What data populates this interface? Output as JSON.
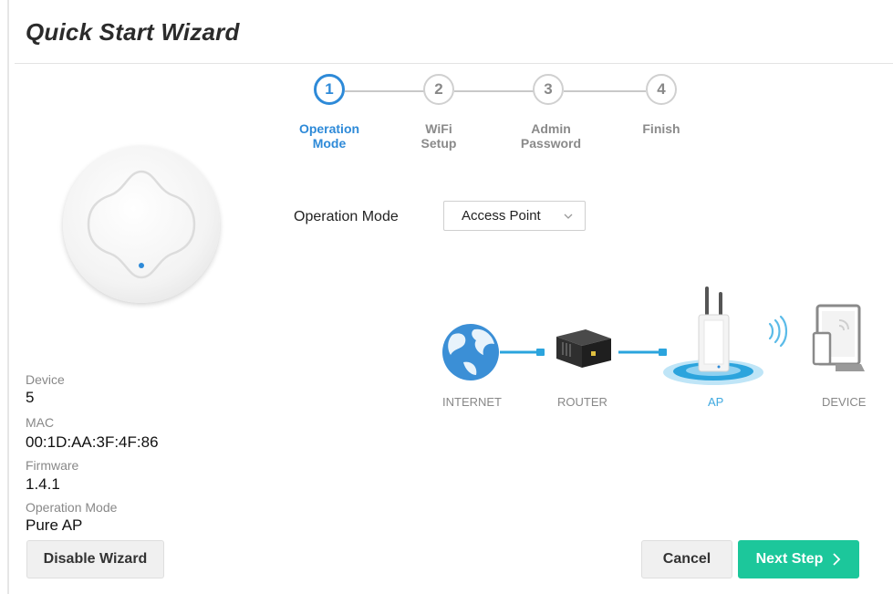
{
  "header": {
    "title": "Quick Start Wizard"
  },
  "steps": [
    {
      "number": "1",
      "label_line1": "Operation",
      "label_line2": "Mode",
      "active": true
    },
    {
      "number": "2",
      "label_line1": "WiFi",
      "label_line2": "Setup",
      "active": false
    },
    {
      "number": "3",
      "label_line1": "Admin",
      "label_line2": "Password",
      "active": false
    },
    {
      "number": "4",
      "label_line1": "Finish",
      "label_line2": "",
      "active": false
    }
  ],
  "device_info": {
    "device_label": "Device",
    "device_value": "5",
    "mac_label": "MAC",
    "mac_value": "00:1D:AA:3F:4F:86",
    "firmware_label": "Firmware",
    "firmware_value": "1.4.1",
    "opmode_label": "Operation Mode",
    "opmode_value": "Pure AP"
  },
  "operation_mode": {
    "label": "Operation Mode",
    "selected": "Access Point"
  },
  "topology": {
    "internet": "INTERNET",
    "router": "ROUTER",
    "ap": "AP",
    "device": "DEVICE"
  },
  "buttons": {
    "disable_wizard": "Disable Wizard",
    "cancel": "Cancel",
    "next_step": "Next Step"
  },
  "colors": {
    "accent_blue": "#2e8ad8",
    "next_green": "#1cc79b",
    "ap_blue": "#3fa9e0"
  },
  "icons": [
    "device-image",
    "caret-down-icon",
    "globe-icon",
    "router-icon",
    "access-point-icon",
    "wifi-signal-icon",
    "devices-icon",
    "chevron-right-icon"
  ]
}
